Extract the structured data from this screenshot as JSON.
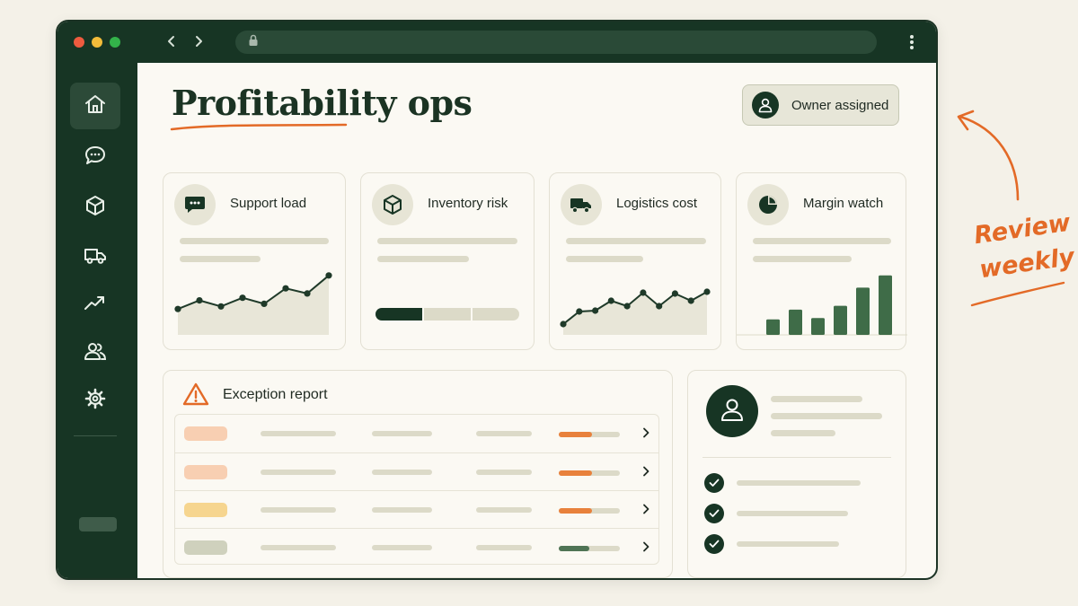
{
  "page": {
    "title": "Profitability ops"
  },
  "owner_button": {
    "label": "Owner assigned"
  },
  "browser": {
    "icons": [
      "chevron-left-icon",
      "chevron-right-icon",
      "lock-icon",
      "kebab-menu-icon"
    ]
  },
  "sidebar": {
    "items": [
      {
        "icon": "home-icon",
        "active": true
      },
      {
        "icon": "chat-icon",
        "active": false
      },
      {
        "icon": "box-icon",
        "active": false
      },
      {
        "icon": "truck-icon",
        "active": false
      },
      {
        "icon": "trend-icon",
        "active": false
      },
      {
        "icon": "users-icon",
        "active": false
      },
      {
        "icon": "gear-icon",
        "active": false
      }
    ]
  },
  "cards": [
    {
      "title": "Support load",
      "icon": "chat-icon",
      "visual": "line-sparkline"
    },
    {
      "title": "Inventory risk",
      "icon": "box-icon",
      "visual": "segmented-progress",
      "segments_filled": 1,
      "segments_total": 3
    },
    {
      "title": "Logistics cost",
      "icon": "truck-icon",
      "visual": "line-sparkline"
    },
    {
      "title": "Margin watch",
      "icon": "pie-chart-icon",
      "visual": "bar-sparkline"
    }
  ],
  "sparklines": {
    "support_load": [
      30,
      40,
      33,
      43,
      36,
      54,
      48,
      69
    ],
    "logistics_cost": [
      12,
      26,
      27,
      38,
      32,
      47,
      32,
      46,
      38,
      48
    ],
    "margin_watch": [
      24,
      39,
      26,
      45,
      73,
      92
    ]
  },
  "exception_report": {
    "title": "Exception report",
    "icon": "warning-icon",
    "rows": [
      {
        "tag_color": "#f8cfb2",
        "progress": 0.55,
        "progress_color": "#e8813c"
      },
      {
        "tag_color": "#f8cfb2",
        "progress": 0.55,
        "progress_color": "#e8813c"
      },
      {
        "tag_color": "#f6d58f",
        "progress": 0.55,
        "progress_color": "#e8813c"
      },
      {
        "tag_color": "#cfd1bd",
        "progress": 0.5,
        "progress_color": "#4f7455"
      }
    ]
  },
  "owner_panel": {
    "checklist_done": [
      true,
      true,
      true
    ]
  },
  "annotation": {
    "line1": "Review",
    "line2": "weekly"
  },
  "colors": {
    "brand_dark": "#173524",
    "accent": "#e36a27",
    "chart_green": "#3f6c48"
  }
}
